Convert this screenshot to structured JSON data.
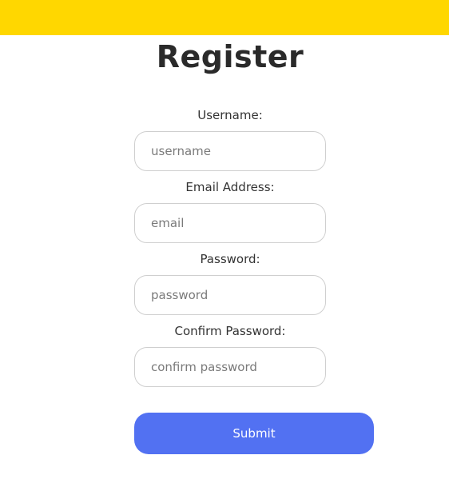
{
  "colors": {
    "top_bar": "#FFD700",
    "submit_button": "#5271F2"
  },
  "page": {
    "title": "Register"
  },
  "form": {
    "fields": [
      {
        "label": "Username:",
        "placeholder": "username",
        "value": ""
      },
      {
        "label": "Email Address:",
        "placeholder": "email",
        "value": ""
      },
      {
        "label": "Password:",
        "placeholder": "password",
        "value": ""
      },
      {
        "label": "Confirm Password:",
        "placeholder": "confirm password",
        "value": ""
      }
    ],
    "submit_label": "Submit"
  }
}
